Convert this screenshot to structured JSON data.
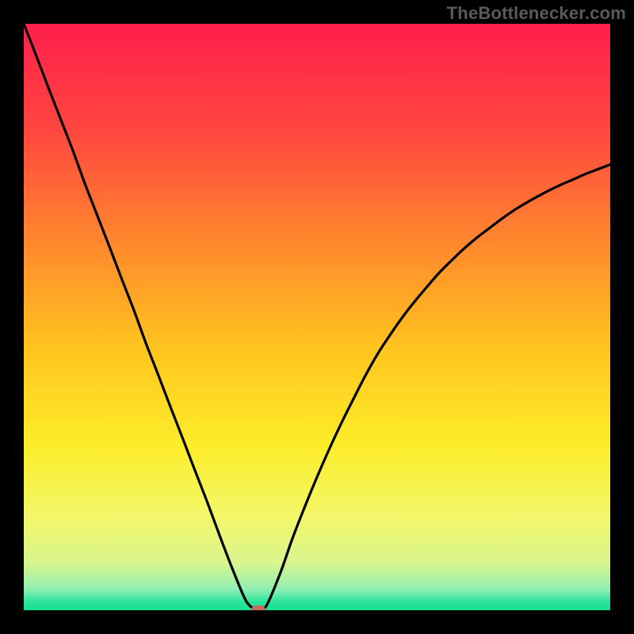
{
  "watermark_text": "TheBottlenecker.com",
  "chart_data": {
    "type": "line",
    "title": "",
    "xlabel": "",
    "ylabel": "",
    "xlim": [
      0,
      100
    ],
    "ylim": [
      0,
      100
    ],
    "gradient_stops": [
      {
        "pos": 0.0,
        "color": "#ff1f4b"
      },
      {
        "pos": 0.18,
        "color": "#ff4640"
      },
      {
        "pos": 0.38,
        "color": "#ff8a2c"
      },
      {
        "pos": 0.56,
        "color": "#ffc61e"
      },
      {
        "pos": 0.72,
        "color": "#fced2a"
      },
      {
        "pos": 0.84,
        "color": "#f3f76a"
      },
      {
        "pos": 0.92,
        "color": "#d8f58e"
      },
      {
        "pos": 0.965,
        "color": "#8feeb3"
      },
      {
        "pos": 0.985,
        "color": "#2de59d"
      },
      {
        "pos": 1.0,
        "color": "#17e08d"
      }
    ],
    "series": [
      {
        "name": "bottleneck-curve",
        "x": [
          0.0,
          2.1,
          4.2,
          6.3,
          8.4,
          10.4,
          12.5,
          14.6,
          16.7,
          18.8,
          20.8,
          22.9,
          25.0,
          27.1,
          29.2,
          31.3,
          33.3,
          35.4,
          37.5,
          38.5,
          39.5,
          40.0,
          40.5,
          41.5,
          43.8,
          45.8,
          47.9,
          50.0,
          52.1,
          54.2,
          56.3,
          58.3,
          60.4,
          62.5,
          64.6,
          66.7,
          68.8,
          70.8,
          72.9,
          75.0,
          77.1,
          79.2,
          81.3,
          83.3,
          85.4,
          87.5,
          89.6,
          91.7,
          93.8,
          95.8,
          97.9,
          100.0
        ],
        "y": [
          100.0,
          94.6,
          89.1,
          83.7,
          78.3,
          72.8,
          67.4,
          62.0,
          56.5,
          51.1,
          45.6,
          40.2,
          34.7,
          29.3,
          23.8,
          18.4,
          13.0,
          7.5,
          2.4,
          0.8,
          0.2,
          0.0,
          0.2,
          1.0,
          6.5,
          12.2,
          17.6,
          22.7,
          27.5,
          32.0,
          36.2,
          40.1,
          43.8,
          47.0,
          50.0,
          52.7,
          55.2,
          57.5,
          59.6,
          61.6,
          63.4,
          65.0,
          66.6,
          68.0,
          69.3,
          70.5,
          71.6,
          72.6,
          73.5,
          74.4,
          75.2,
          76.0
        ]
      }
    ],
    "marker": {
      "x": 40.0,
      "y": 0.0
    }
  }
}
